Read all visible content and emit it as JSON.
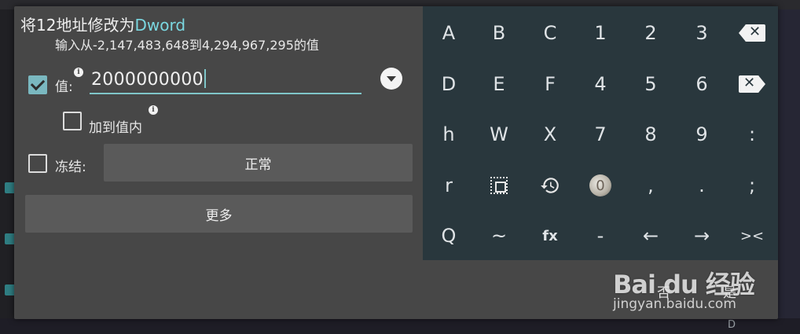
{
  "dialog": {
    "title_prefix": "将12地址修改为",
    "title_type": "Dword",
    "subtitle": "输入从-2,147,483,648到4,294,967,295的值"
  },
  "value_row": {
    "checked": true,
    "label": "值:",
    "value": "2000000000"
  },
  "add_to_value": {
    "checked": false,
    "label": "加到值内"
  },
  "freeze_row": {
    "checked": false,
    "label": "冻结:",
    "mode_button": "正常"
  },
  "more_button": "更多",
  "actions": {
    "cancel": "否",
    "ok": "是"
  },
  "keyboard": {
    "rows": [
      [
        "A",
        "B",
        "C",
        "1",
        "2",
        "3",
        "backspace"
      ],
      [
        "D",
        "E",
        "F",
        "4",
        "5",
        "6",
        "backspace"
      ],
      [
        "h",
        "W",
        "X",
        "7",
        "8",
        "9",
        ":"
      ],
      [
        "r",
        "select",
        "history",
        "0",
        ",",
        ".",
        ";"
      ],
      [
        "Q",
        "~",
        "fx",
        "-",
        "←",
        "→",
        "><"
      ]
    ]
  },
  "background": {
    "bottom_letter": "D"
  },
  "watermark": {
    "logo": "Bai du 经验",
    "url": "jingyan.baidu.com"
  },
  "colors": {
    "dialog_bg": "#474747",
    "keyboard_bg": "#29373d",
    "accent": "#7ad7e0",
    "button_bg": "#5a5a5a"
  },
  "icons": [
    "info-icon",
    "dropdown-icon",
    "backspace-icon",
    "select-all-icon",
    "history-icon"
  ]
}
